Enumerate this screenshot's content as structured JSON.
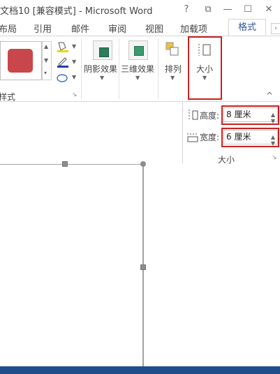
{
  "window": {
    "title": "文档10 [兼容模式] - Microsoft Word",
    "help_glyph": "?",
    "restore_glyph": "⧉",
    "minimize_glyph": "—",
    "maximize_glyph": "☐",
    "close_glyph": "✕"
  },
  "tabs": [
    {
      "label": "布局"
    },
    {
      "label": "引用"
    },
    {
      "label": "邮件"
    },
    {
      "label": "审阅"
    },
    {
      "label": "视图"
    },
    {
      "label": "加载项"
    },
    {
      "label": "格式"
    }
  ],
  "ribbon": {
    "shape_styles_group_label": "样式",
    "shadow_effects_label": "阴影效果",
    "threed_effects_label": "三维效果",
    "arrange_label": "排列",
    "size_label": "大小",
    "collapse_glyph": "^"
  },
  "size_panel": {
    "height_label": "高度:",
    "height_value": "8 厘米",
    "width_label": "宽度:",
    "width_value": "6 厘米",
    "group_label": "大小"
  },
  "colors": {
    "shape_fill": "#c9474a",
    "accent": "#2b579a",
    "highlight_box": "#cc1f1f",
    "taskbar": "#1f4e8a"
  }
}
